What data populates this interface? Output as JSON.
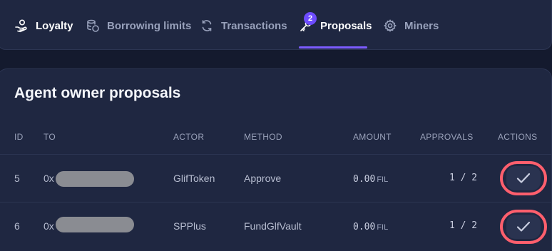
{
  "tabs": [
    {
      "label": "Loyalty",
      "icon": "hand-coin-icon"
    },
    {
      "label": "Borrowing limits",
      "icon": "coin-stack-icon"
    },
    {
      "label": "Transactions",
      "icon": "refresh-icon"
    },
    {
      "label": "Proposals",
      "icon": "key-icon",
      "badge": "2",
      "active": true
    },
    {
      "label": "Miners",
      "icon": "gear-icon"
    }
  ],
  "proposals": {
    "title": "Agent owner proposals",
    "columns": {
      "id": "ID",
      "to": "TO",
      "actor": "ACTOR",
      "method": "METHOD",
      "amount": "AMOUNT",
      "approvals": "APPROVALS",
      "actions": "ACTIONS"
    },
    "rows": [
      {
        "id": "5",
        "to_prefix": "0x",
        "actor": "GlifToken",
        "method": "Approve",
        "amount": "0.00",
        "unit": "FIL",
        "approvals": "1 / 2"
      },
      {
        "id": "6",
        "to_prefix": "0x",
        "actor": "SPPlus",
        "method": "FundGlfVault",
        "amount": "0.00",
        "unit": "FIL",
        "approvals": "1 / 2"
      }
    ]
  },
  "colors": {
    "background": "#141a2e",
    "card": "#1f2741",
    "accent": "#7c5cff",
    "highlight_ring": "#ff5f6d"
  }
}
